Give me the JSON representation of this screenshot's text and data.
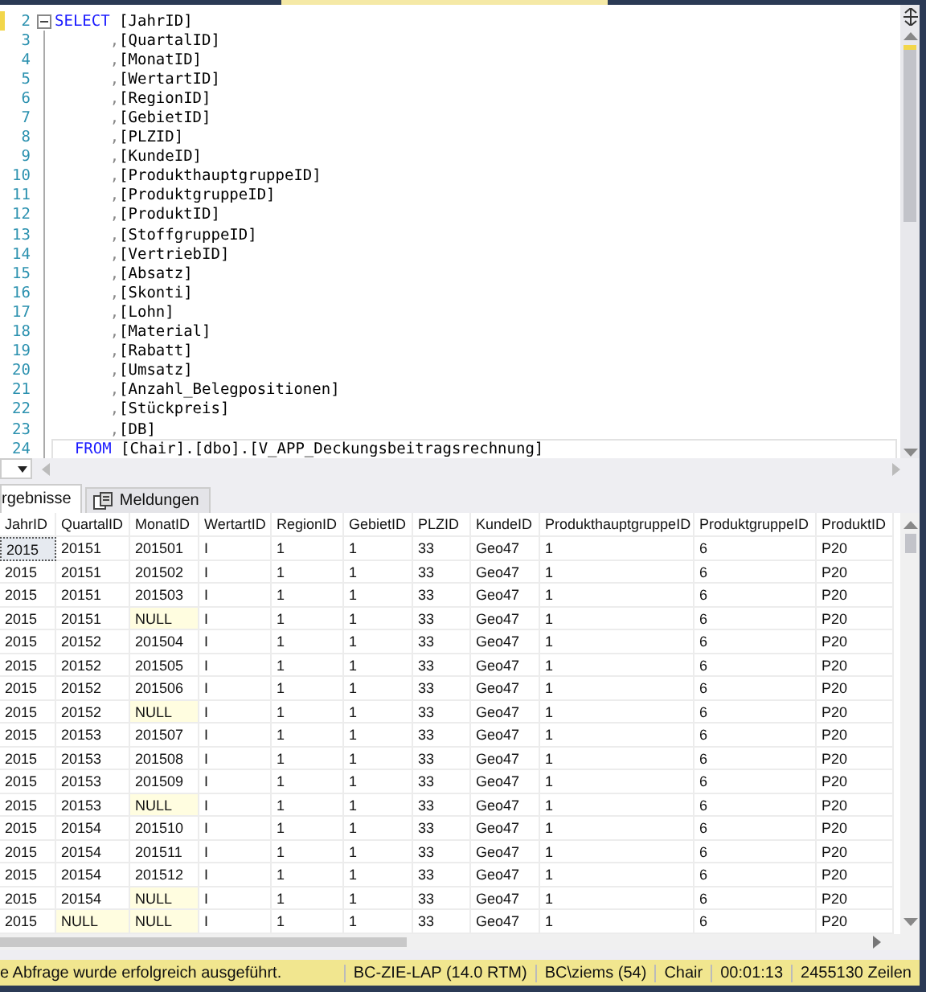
{
  "editor": {
    "lines": [
      {
        "number": "2",
        "tokens": [
          {
            "t": "SELECT",
            "kind": "keyword"
          },
          {
            "t": " [JahrID]",
            "kind": "plain"
          }
        ],
        "modified": true,
        "fold": true
      },
      {
        "number": "3",
        "tokens": [
          {
            "t": "      ,",
            "kind": "punct"
          },
          {
            "t": "[QuartalID]",
            "kind": "plain"
          }
        ]
      },
      {
        "number": "4",
        "tokens": [
          {
            "t": "      ,",
            "kind": "punct"
          },
          {
            "t": "[MonatID]",
            "kind": "plain"
          }
        ]
      },
      {
        "number": "5",
        "tokens": [
          {
            "t": "      ,",
            "kind": "punct"
          },
          {
            "t": "[WertartID]",
            "kind": "plain"
          }
        ]
      },
      {
        "number": "6",
        "tokens": [
          {
            "t": "      ,",
            "kind": "punct"
          },
          {
            "t": "[RegionID]",
            "kind": "plain"
          }
        ]
      },
      {
        "number": "7",
        "tokens": [
          {
            "t": "      ,",
            "kind": "punct"
          },
          {
            "t": "[GebietID]",
            "kind": "plain"
          }
        ]
      },
      {
        "number": "8",
        "tokens": [
          {
            "t": "      ,",
            "kind": "punct"
          },
          {
            "t": "[PLZID]",
            "kind": "plain"
          }
        ]
      },
      {
        "number": "9",
        "tokens": [
          {
            "t": "      ,",
            "kind": "punct"
          },
          {
            "t": "[KundeID]",
            "kind": "plain"
          }
        ]
      },
      {
        "number": "10",
        "tokens": [
          {
            "t": "      ,",
            "kind": "punct"
          },
          {
            "t": "[ProdukthauptgruppeID]",
            "kind": "plain"
          }
        ]
      },
      {
        "number": "11",
        "tokens": [
          {
            "t": "      ,",
            "kind": "punct"
          },
          {
            "t": "[ProduktgruppeID]",
            "kind": "plain"
          }
        ]
      },
      {
        "number": "12",
        "tokens": [
          {
            "t": "      ,",
            "kind": "punct"
          },
          {
            "t": "[ProduktID]",
            "kind": "plain"
          }
        ]
      },
      {
        "number": "13",
        "tokens": [
          {
            "t": "      ,",
            "kind": "punct"
          },
          {
            "t": "[StoffgruppeID]",
            "kind": "plain"
          }
        ]
      },
      {
        "number": "14",
        "tokens": [
          {
            "t": "      ,",
            "kind": "punct"
          },
          {
            "t": "[VertriebID]",
            "kind": "plain"
          }
        ]
      },
      {
        "number": "15",
        "tokens": [
          {
            "t": "      ,",
            "kind": "punct"
          },
          {
            "t": "[Absatz]",
            "kind": "plain"
          }
        ]
      },
      {
        "number": "16",
        "tokens": [
          {
            "t": "      ,",
            "kind": "punct"
          },
          {
            "t": "[Skonti]",
            "kind": "plain"
          }
        ]
      },
      {
        "number": "17",
        "tokens": [
          {
            "t": "      ,",
            "kind": "punct"
          },
          {
            "t": "[Lohn]",
            "kind": "plain"
          }
        ]
      },
      {
        "number": "18",
        "tokens": [
          {
            "t": "      ,",
            "kind": "punct"
          },
          {
            "t": "[Material]",
            "kind": "plain"
          }
        ]
      },
      {
        "number": "19",
        "tokens": [
          {
            "t": "      ,",
            "kind": "punct"
          },
          {
            "t": "[Rabatt]",
            "kind": "plain"
          }
        ]
      },
      {
        "number": "20",
        "tokens": [
          {
            "t": "      ,",
            "kind": "punct"
          },
          {
            "t": "[Umsatz]",
            "kind": "plain"
          }
        ]
      },
      {
        "number": "21",
        "tokens": [
          {
            "t": "      ,",
            "kind": "punct"
          },
          {
            "t": "[Anzahl_Belegpositionen]",
            "kind": "plain"
          }
        ]
      },
      {
        "number": "22",
        "tokens": [
          {
            "t": "      ,",
            "kind": "punct"
          },
          {
            "t": "[Stückpreis]",
            "kind": "plain"
          }
        ]
      },
      {
        "number": "23",
        "tokens": [
          {
            "t": "      ,",
            "kind": "punct"
          },
          {
            "t": "[DB]",
            "kind": "plain"
          }
        ]
      },
      {
        "number": "24",
        "tokens": [
          {
            "t": "  FROM",
            "kind": "keyword"
          },
          {
            "t": " [Chair].[dbo].[V_APP_Deckungsbeitragsrechnung]",
            "kind": "plain"
          }
        ],
        "current": true
      }
    ]
  },
  "result_tabs": [
    {
      "label": "rgebnisse",
      "selected": true
    },
    {
      "label": "Meldungen",
      "selected": false
    }
  ],
  "grid": {
    "columns": [
      "JahrID",
      "QuartalID",
      "MonatID",
      "WertartID",
      "RegionID",
      "GebietID",
      "PLZID",
      "KundeID",
      "ProdukthauptgruppeID",
      "ProduktgruppeID",
      "ProduktID"
    ],
    "rows": [
      {
        "cells": [
          "2015",
          "20151",
          "201501",
          "I",
          "1",
          "1",
          "33",
          "Geo47",
          "1",
          "6",
          "P20"
        ],
        "null_flags": [
          false,
          false,
          false,
          false,
          false,
          false,
          false,
          false,
          false,
          false,
          false
        ],
        "selected": true
      },
      {
        "cells": [
          "2015",
          "20151",
          "201502",
          "I",
          "1",
          "1",
          "33",
          "Geo47",
          "1",
          "6",
          "P20"
        ],
        "null_flags": [
          false,
          false,
          false,
          false,
          false,
          false,
          false,
          false,
          false,
          false,
          false
        ],
        "selected": false
      },
      {
        "cells": [
          "2015",
          "20151",
          "201503",
          "I",
          "1",
          "1",
          "33",
          "Geo47",
          "1",
          "6",
          "P20"
        ],
        "null_flags": [
          false,
          false,
          false,
          false,
          false,
          false,
          false,
          false,
          false,
          false,
          false
        ],
        "selected": false
      },
      {
        "cells": [
          "2015",
          "20151",
          "NULL",
          "I",
          "1",
          "1",
          "33",
          "Geo47",
          "1",
          "6",
          "P20"
        ],
        "null_flags": [
          false,
          false,
          true,
          false,
          false,
          false,
          false,
          false,
          false,
          false,
          false
        ],
        "selected": false
      },
      {
        "cells": [
          "2015",
          "20152",
          "201504",
          "I",
          "1",
          "1",
          "33",
          "Geo47",
          "1",
          "6",
          "P20"
        ],
        "null_flags": [
          false,
          false,
          false,
          false,
          false,
          false,
          false,
          false,
          false,
          false,
          false
        ],
        "selected": false
      },
      {
        "cells": [
          "2015",
          "20152",
          "201505",
          "I",
          "1",
          "1",
          "33",
          "Geo47",
          "1",
          "6",
          "P20"
        ],
        "null_flags": [
          false,
          false,
          false,
          false,
          false,
          false,
          false,
          false,
          false,
          false,
          false
        ],
        "selected": false
      },
      {
        "cells": [
          "2015",
          "20152",
          "201506",
          "I",
          "1",
          "1",
          "33",
          "Geo47",
          "1",
          "6",
          "P20"
        ],
        "null_flags": [
          false,
          false,
          false,
          false,
          false,
          false,
          false,
          false,
          false,
          false,
          false
        ],
        "selected": false
      },
      {
        "cells": [
          "2015",
          "20152",
          "NULL",
          "I",
          "1",
          "1",
          "33",
          "Geo47",
          "1",
          "6",
          "P20"
        ],
        "null_flags": [
          false,
          false,
          true,
          false,
          false,
          false,
          false,
          false,
          false,
          false,
          false
        ],
        "selected": false
      },
      {
        "cells": [
          "2015",
          "20153",
          "201507",
          "I",
          "1",
          "1",
          "33",
          "Geo47",
          "1",
          "6",
          "P20"
        ],
        "null_flags": [
          false,
          false,
          false,
          false,
          false,
          false,
          false,
          false,
          false,
          false,
          false
        ],
        "selected": false
      },
      {
        "cells": [
          "2015",
          "20153",
          "201508",
          "I",
          "1",
          "1",
          "33",
          "Geo47",
          "1",
          "6",
          "P20"
        ],
        "null_flags": [
          false,
          false,
          false,
          false,
          false,
          false,
          false,
          false,
          false,
          false,
          false
        ],
        "selected": false
      },
      {
        "cells": [
          "2015",
          "20153",
          "201509",
          "I",
          "1",
          "1",
          "33",
          "Geo47",
          "1",
          "6",
          "P20"
        ],
        "null_flags": [
          false,
          false,
          false,
          false,
          false,
          false,
          false,
          false,
          false,
          false,
          false
        ],
        "selected": false
      },
      {
        "cells": [
          "2015",
          "20153",
          "NULL",
          "I",
          "1",
          "1",
          "33",
          "Geo47",
          "1",
          "6",
          "P20"
        ],
        "null_flags": [
          false,
          false,
          true,
          false,
          false,
          false,
          false,
          false,
          false,
          false,
          false
        ],
        "selected": false
      },
      {
        "cells": [
          "2015",
          "20154",
          "201510",
          "I",
          "1",
          "1",
          "33",
          "Geo47",
          "1",
          "6",
          "P20"
        ],
        "null_flags": [
          false,
          false,
          false,
          false,
          false,
          false,
          false,
          false,
          false,
          false,
          false
        ],
        "selected": false
      },
      {
        "cells": [
          "2015",
          "20154",
          "201511",
          "I",
          "1",
          "1",
          "33",
          "Geo47",
          "1",
          "6",
          "P20"
        ],
        "null_flags": [
          false,
          false,
          false,
          false,
          false,
          false,
          false,
          false,
          false,
          false,
          false
        ],
        "selected": false
      },
      {
        "cells": [
          "2015",
          "20154",
          "201512",
          "I",
          "1",
          "1",
          "33",
          "Geo47",
          "1",
          "6",
          "P20"
        ],
        "null_flags": [
          false,
          false,
          false,
          false,
          false,
          false,
          false,
          false,
          false,
          false,
          false
        ],
        "selected": false
      },
      {
        "cells": [
          "2015",
          "20154",
          "NULL",
          "I",
          "1",
          "1",
          "33",
          "Geo47",
          "1",
          "6",
          "P20"
        ],
        "null_flags": [
          false,
          false,
          true,
          false,
          false,
          false,
          false,
          false,
          false,
          false,
          false
        ],
        "selected": false
      },
      {
        "cells": [
          "2015",
          "NULL",
          "NULL",
          "I",
          "1",
          "1",
          "33",
          "Geo47",
          "1",
          "6",
          "P20"
        ],
        "null_flags": [
          false,
          true,
          true,
          false,
          false,
          false,
          false,
          false,
          false,
          false,
          false
        ],
        "selected": false
      }
    ]
  },
  "status_bar": {
    "message": "e Abfrage wurde erfolgreich ausgeführt.",
    "server": "BC-ZIE-LAP (14.0 RTM)",
    "user": "BC\\ziems (54)",
    "database": "Chair",
    "elapsed": "00:01:13",
    "rows": "2455130 Zeilen"
  }
}
